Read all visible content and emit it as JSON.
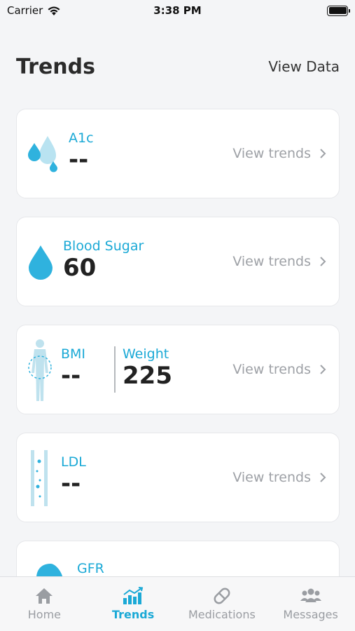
{
  "status_bar": {
    "carrier": "Carrier",
    "time": "3:38 PM"
  },
  "header": {
    "title": "Trends",
    "view_data": "View Data"
  },
  "cards": [
    {
      "label": "A1c",
      "value": "--",
      "link": "View trends"
    },
    {
      "label": "Blood Sugar",
      "value": "60",
      "link": "View trends"
    },
    {
      "label": "BMI",
      "value": "--",
      "label2": "Weight",
      "value2": "225",
      "link": "View trends"
    },
    {
      "label": "LDL",
      "value": "--",
      "link": "View trends"
    },
    {
      "label": "GFR"
    }
  ],
  "tabs": [
    {
      "label": "Home",
      "icon": "home-icon"
    },
    {
      "label": "Trends",
      "icon": "trends-icon",
      "active": true
    },
    {
      "label": "Medications",
      "icon": "pill-icon"
    },
    {
      "label": "Messages",
      "icon": "people-icon"
    }
  ],
  "colors": {
    "accent": "#1ba9d6",
    "muted": "#9ea1a6",
    "background": "#f4f5f7"
  }
}
